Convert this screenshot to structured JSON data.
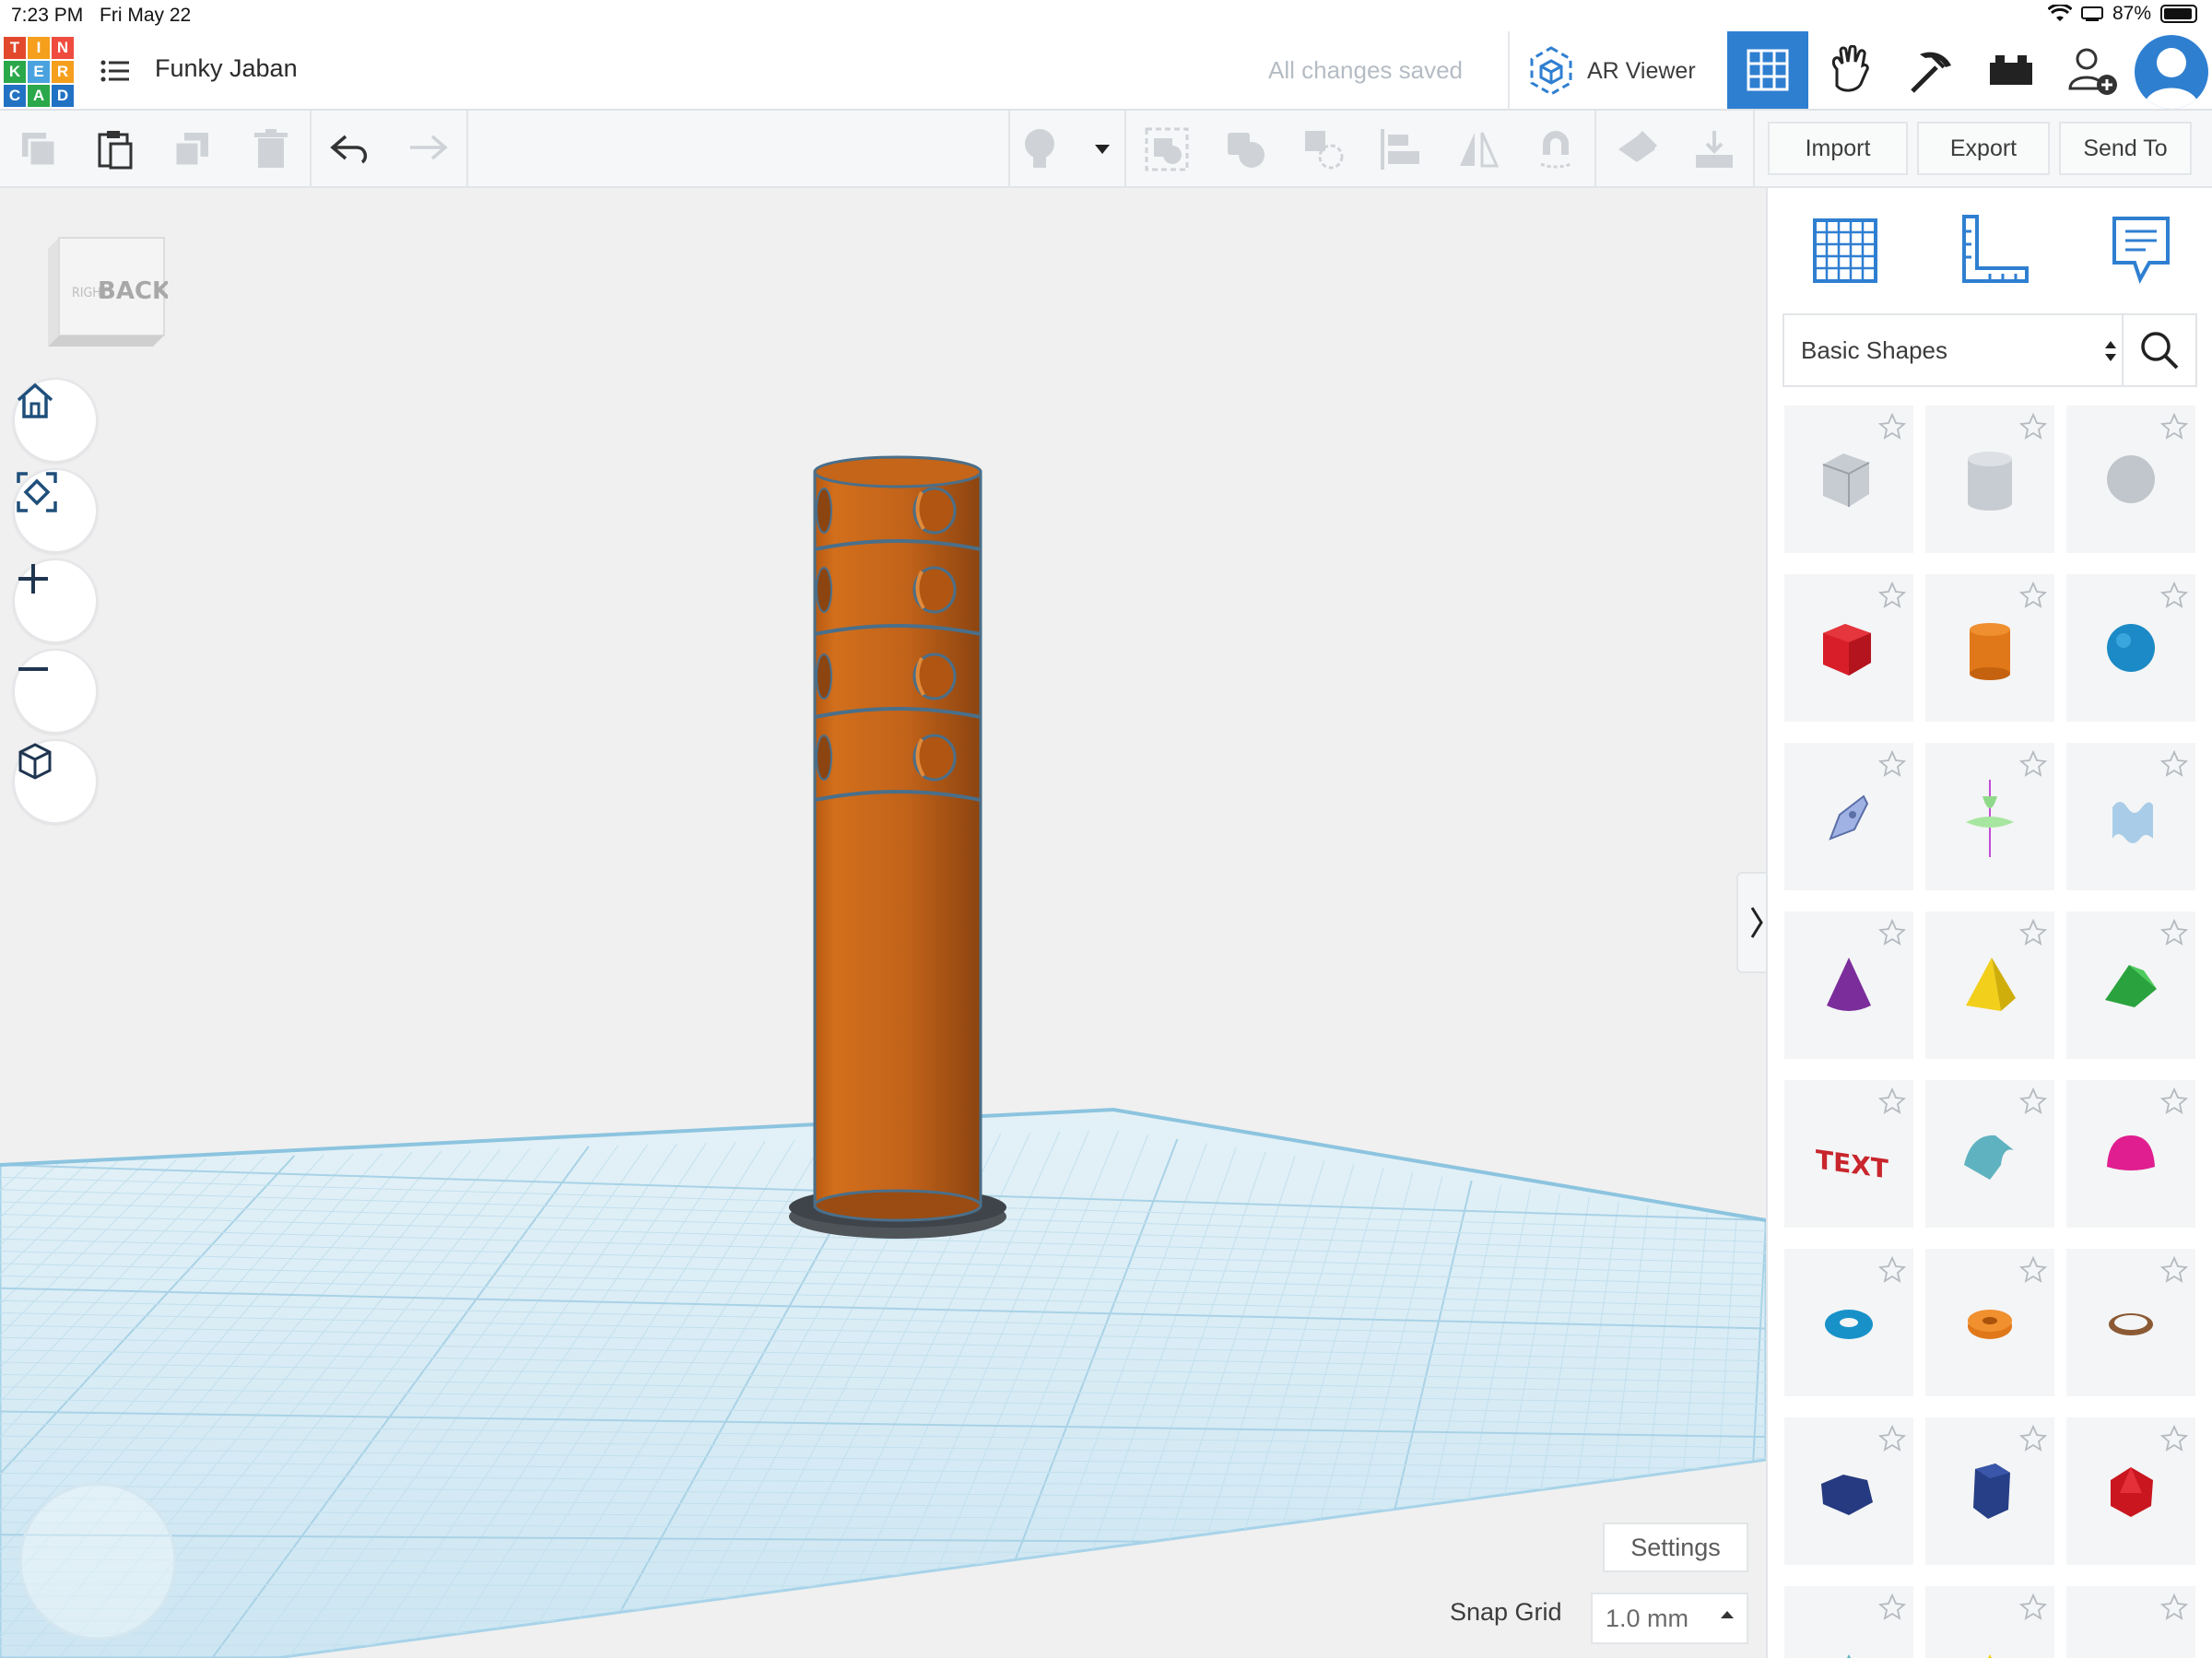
{
  "status_bar": {
    "time": "7:23 PM",
    "date": "Fri May 22",
    "battery": "87%"
  },
  "logo": {
    "letters": [
      "T",
      "I",
      "N",
      "K",
      "E",
      "R",
      "C",
      "A",
      "D"
    ],
    "colors": [
      "#e2482c",
      "#f59f1d",
      "#ef4c3f",
      "#2ba84a",
      "#4aa3df",
      "#f59f1d",
      "#2272c3",
      "#2ba84a",
      "#2272c3"
    ]
  },
  "header": {
    "project_title": "Funky Jaban",
    "save_status": "All changes saved",
    "ar_viewer_label": "AR Viewer"
  },
  "toolbar": {
    "import_label": "Import",
    "export_label": "Export",
    "send_to_label": "Send To"
  },
  "viewcube": {
    "faces": [
      "RIGHT",
      "BACK"
    ]
  },
  "workspace": {
    "settings_label": "Settings",
    "snap_grid_label": "Snap Grid",
    "snap_grid_value": "1.0 mm"
  },
  "panel": {
    "category": "Basic Shapes",
    "shapes": [
      "box-hole",
      "cylinder-hole",
      "sphere-hole",
      "box",
      "cylinder",
      "sphere",
      "scribble",
      "sketch-top",
      "shape-generator",
      "cone",
      "pyramid",
      "wedge",
      "text",
      "half-cylinder",
      "paraboloid",
      "torus",
      "tube",
      "ring",
      "polygon",
      "prism",
      "icosahedron",
      "star",
      "star-yellow",
      "heart"
    ]
  },
  "colors": {
    "accent": "#2f7fd1",
    "model": "#c7661a",
    "grid": "#cfe7f3"
  }
}
